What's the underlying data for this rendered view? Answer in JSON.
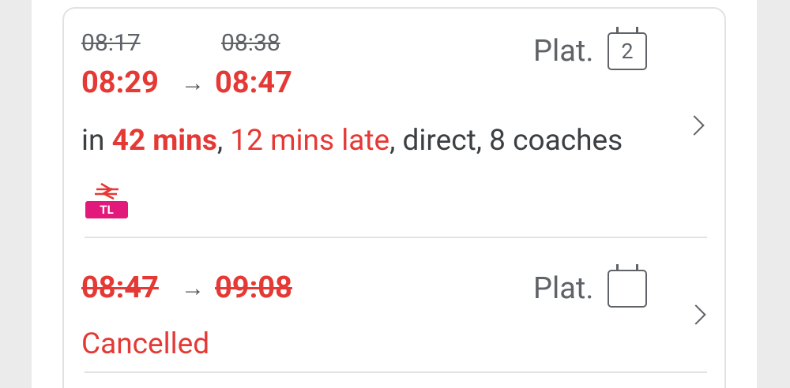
{
  "services": [
    {
      "scheduled_departure": "08:17",
      "scheduled_arrival": "08:38",
      "expected_departure": "08:29",
      "expected_arrival": "08:47",
      "arrow": "→",
      "platform_label": "Plat.",
      "platform_number": "2",
      "info": {
        "prefix": "in ",
        "eta": "42 mins",
        "sep1": ", ",
        "delay": "12 mins late",
        "rest": ", direct, 8 coaches"
      },
      "operator": {
        "code": "TL",
        "icon": "national-rail-icon",
        "color": "#e2187b"
      }
    },
    {
      "departure": "08:47",
      "arrival": "09:08",
      "arrow": "→",
      "platform_label": "Plat.",
      "platform_number": "",
      "status": "Cancelled"
    }
  ],
  "colors": {
    "late_red": "#e53935",
    "text_grey": "#5f6368",
    "operator_pink": "#e2187b"
  }
}
